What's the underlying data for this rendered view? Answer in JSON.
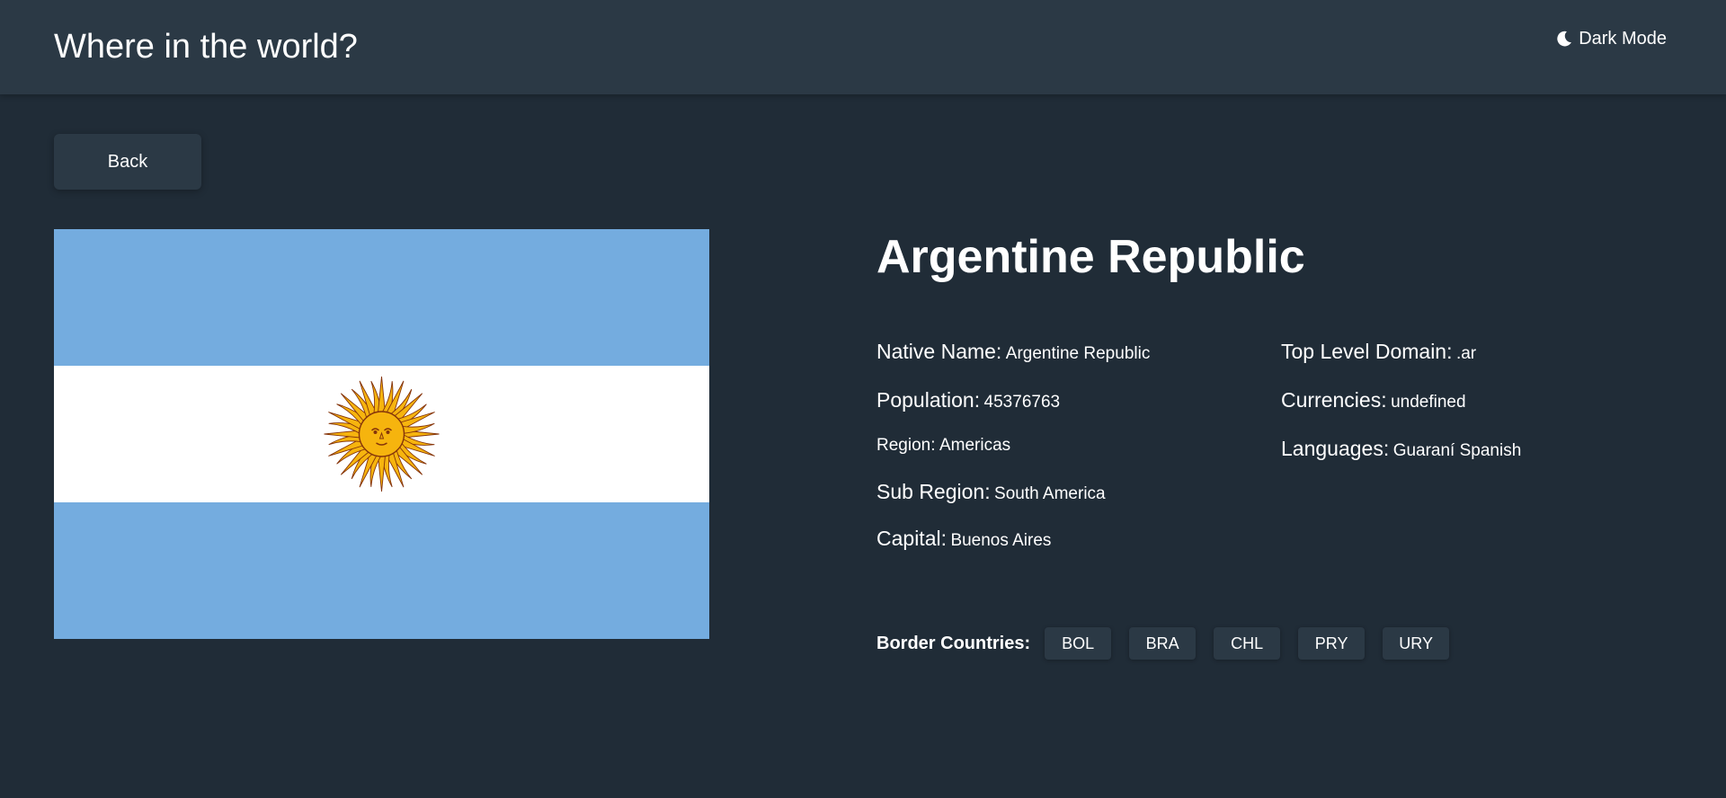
{
  "header": {
    "title": "Where in the world?",
    "theme_toggle_label": "Dark Mode",
    "theme_icon": "moon-icon"
  },
  "back_button": {
    "label": "Back"
  },
  "flag": {
    "icon": "argentina-flag",
    "colors": {
      "celeste": "#74acdf",
      "white": "#ffffff",
      "sun": "#f6b40e",
      "sun_outline": "#85340a"
    }
  },
  "country": {
    "name": "Argentine Republic",
    "details_left": [
      {
        "label": "Native Name:",
        "value": "Argentine Republic"
      },
      {
        "label": "Population:",
        "value": "45376763"
      },
      {
        "label": "Region:",
        "value": "Americas"
      },
      {
        "label": "Sub Region:",
        "value": "South America"
      },
      {
        "label": "Capital:",
        "value": "Buenos Aires"
      }
    ],
    "details_right": [
      {
        "label": "Top Level Domain:",
        "value": ".ar"
      },
      {
        "label": "Currencies:",
        "value": "undefined"
      },
      {
        "label": "Languages:",
        "value": "Guaraní Spanish"
      }
    ],
    "borders_label": "Border Countries:",
    "borders": [
      "BOL",
      "BRA",
      "CHL",
      "PRY",
      "URY"
    ]
  },
  "theme": {
    "background": "#202c37",
    "elements": "#2b3945",
    "text": "#ffffff"
  }
}
